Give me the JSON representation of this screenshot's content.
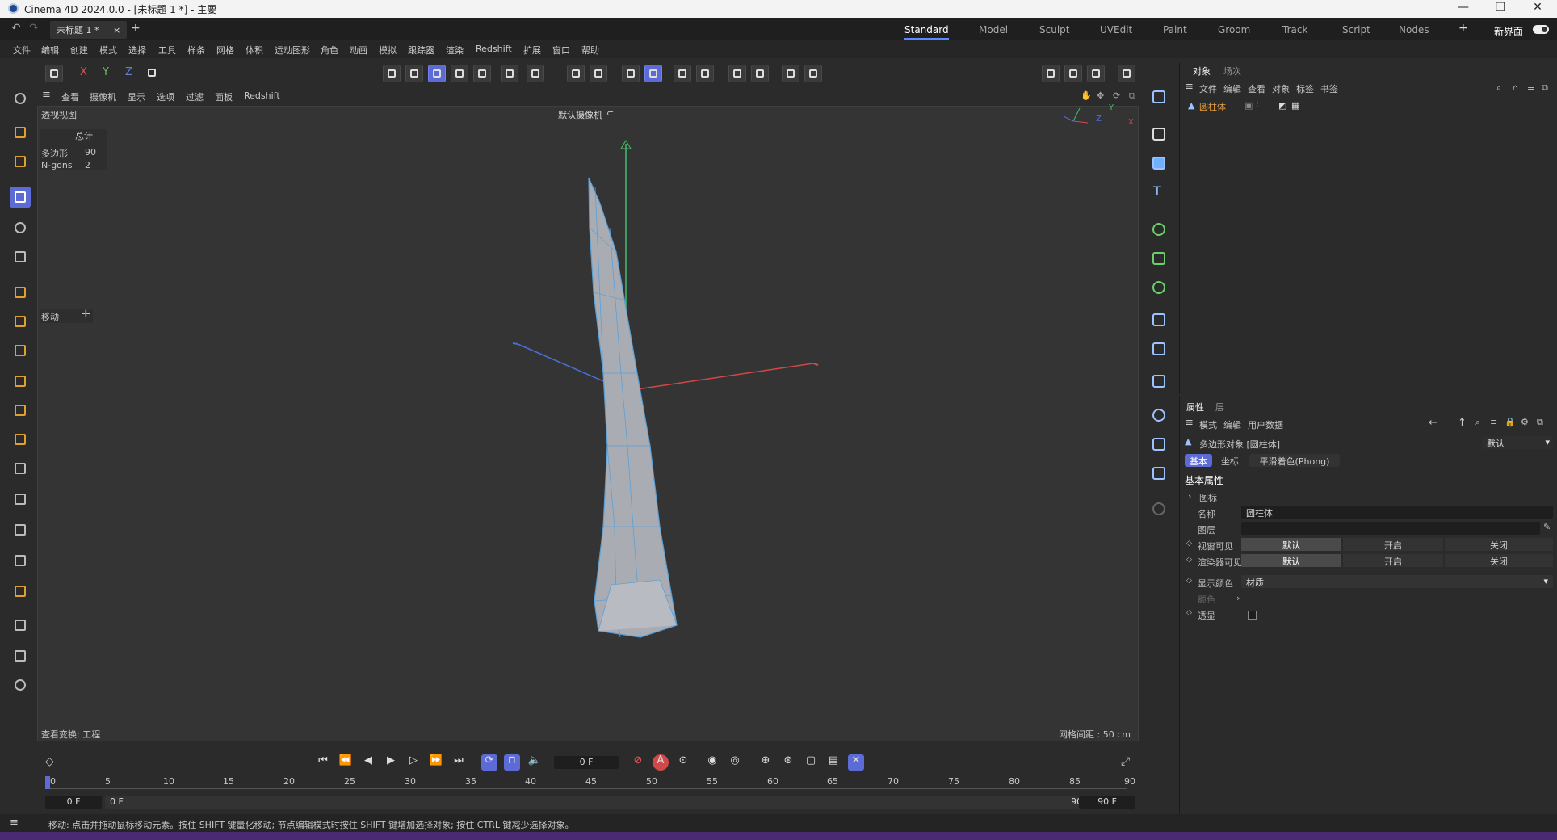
{
  "window": {
    "title": "Cinema 4D 2024.0.0 - [未标题 1 *] - 主要",
    "controls": [
      "—",
      "❐",
      "✕"
    ]
  },
  "tabs": {
    "doc": "未标题 1 *",
    "close": "×",
    "add": "+",
    "layouts": [
      "Standard",
      "Model",
      "Sculpt",
      "UVEdit",
      "Paint",
      "Groom",
      "Track",
      "Script",
      "Nodes"
    ],
    "active_layout": "Standard",
    "new_ui": "新界面",
    "plus": "+"
  },
  "menu": [
    "文件",
    "编辑",
    "创建",
    "模式",
    "选择",
    "工具",
    "样条",
    "网格",
    "体积",
    "运动图形",
    "角色",
    "动画",
    "模拟",
    "跟踪器",
    "渲染",
    "Redshift",
    "扩展",
    "窗口",
    "帮助"
  ],
  "axis_toggles": [
    "X",
    "Y",
    "Z"
  ],
  "viewport": {
    "menu": [
      "查看",
      "摄像机",
      "显示",
      "选项",
      "过滤",
      "面板",
      "Redshift"
    ],
    "name": "透视视图",
    "camera": "默认摄像机",
    "stats": {
      "header": "总计",
      "rows": [
        {
          "label": "多边形",
          "value": "90"
        },
        {
          "label": "N-gons",
          "value": "2"
        }
      ]
    },
    "tool_label": "移动",
    "bottom_left": "查看变换: 工程",
    "grid": "网格间距 : 50 cm",
    "axis_labels": {
      "y": "Y",
      "z": "Z",
      "x": "X"
    }
  },
  "timeline": {
    "current": "0 F",
    "start": "0 F",
    "range_start": "0 F",
    "end": "90 F",
    "range_end": "90 F",
    "ticks": [
      "0",
      "5",
      "10",
      "15",
      "20",
      "25",
      "30",
      "35",
      "40",
      "45",
      "50",
      "55",
      "60",
      "65",
      "70",
      "75",
      "80",
      "85",
      "90"
    ]
  },
  "status": "移动: 点击并拖动鼠标移动元素。按住 SHIFT 键量化移动; 节点编辑模式时按住 SHIFT 键增加选择对象; 按住 CTRL 键减少选择对象。",
  "objects": {
    "tabs": [
      "对象",
      "场次"
    ],
    "menu": [
      "文件",
      "编辑",
      "查看",
      "对象",
      "标签",
      "书签"
    ],
    "items": [
      {
        "name": "圆柱体"
      }
    ]
  },
  "attributes": {
    "tabs": [
      "属性",
      "层"
    ],
    "menu": [
      "模式",
      "编辑",
      "用户数据"
    ],
    "object_type": "多边形对象 [圆柱体]",
    "preset": "默认",
    "subtabs": [
      "基本",
      "坐标",
      "平滑着色(Phong)"
    ],
    "section": "基本属性",
    "group": "图标",
    "name_label": "名称",
    "name_value": "圆柱体",
    "layer_label": "图层",
    "editor_visible": {
      "label": "视窗可见",
      "options": [
        "默认",
        "开启",
        "关闭"
      ]
    },
    "render_visible": {
      "label": "渲染器可见",
      "options": [
        "默认",
        "开启",
        "关闭"
      ]
    },
    "display_color": {
      "label": "显示颜色",
      "value": "材质"
    },
    "color_label": "颜色",
    "xray_label": "透显"
  },
  "colors": {
    "accent": "#5d6bd6",
    "y_axis": "#3ec16a",
    "x_axis": "#d04848",
    "z_axis": "#4a6fd8",
    "mesh": "#a9adb3",
    "wire": "#5aa0d8"
  }
}
